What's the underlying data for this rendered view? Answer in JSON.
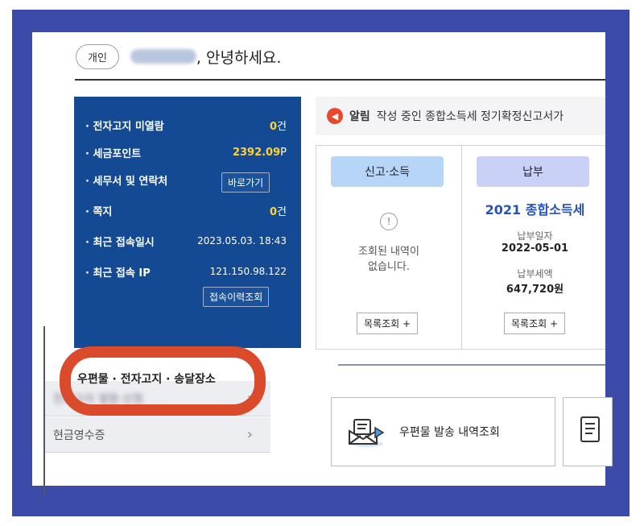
{
  "greeting": {
    "badge": "개인",
    "suffix": ", 안녕하세요."
  },
  "summary": {
    "rows": [
      {
        "label": "· 전자고지 미열람",
        "value": "0",
        "unit": "건"
      },
      {
        "label": "· 세금포인트",
        "value": "2392.09",
        "unit": "P"
      },
      {
        "label": "· 세무서 및 연락처",
        "button": "바로가기"
      },
      {
        "label": "· 쪽지",
        "value": "0",
        "unit": "건"
      },
      {
        "label": "· 최근 접속일시",
        "value": "2023.05.03.  18:43"
      },
      {
        "label": "· 최근 접속 IP",
        "value": "121.150.98.122"
      }
    ],
    "history_button": "접속이력조회"
  },
  "alert": {
    "tag": "알림",
    "text": "작성 중인 종합소득세 정기확정신고서가"
  },
  "cards": {
    "report": {
      "title": "신고·소득",
      "empty_line1": "조회된 내역이",
      "empty_line2": "없습니다.",
      "button": "목록조회 +"
    },
    "payment": {
      "title": "납부",
      "tax_name": "2021 종합소득세",
      "date_label": "납부일자",
      "date": "2022-05-01",
      "amount_label": "납부세액",
      "amount": "647,720원",
      "button": "목록조회 +"
    }
  },
  "side_tab": {
    "title": "우편물 · 전자고지 · 송달장소",
    "items": [
      {
        "label": "전자고지 열람·신청"
      },
      {
        "label": "현금영수증"
      }
    ]
  },
  "post_card": {
    "label": "우편물 발송 내역조회"
  },
  "colors": {
    "frame": "#3c4ba8",
    "summary_bg": "#144a93",
    "highlight": "#d94b2a",
    "point": "#ffd233",
    "tax_title": "#2553b5"
  }
}
